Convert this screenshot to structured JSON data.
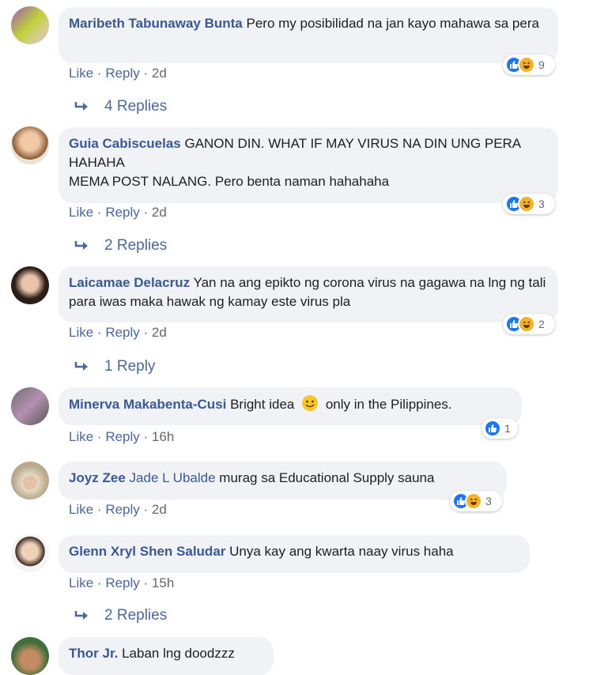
{
  "comments": [
    {
      "author": "Maribeth Tabunaway Bunta",
      "tag": "",
      "text": "Pero my posibilidad na jan kayo mahawa sa pera",
      "reaction_count": "9",
      "like": "Like",
      "reply": "Reply",
      "time": "2d",
      "replies": "4 Replies"
    },
    {
      "author": "Guia Cabiscuelas",
      "tag": "",
      "text": "GANON DIN. WHAT IF MAY VIRUS NA DIN UNG PERA HAHAHA",
      "text2": "MEMA POST NALANG. Pero benta naman hahahaha",
      "reaction_count": "3",
      "like": "Like",
      "reply": "Reply",
      "time": "2d",
      "replies": "2 Replies"
    },
    {
      "author": "Laicamae Delacruz",
      "tag": "",
      "text": "Yan na ang epikto ng corona virus na gagawa na lng ng tali para iwas maka hawak ng kamay este virus pla",
      "reaction_count": "2",
      "like": "Like",
      "reply": "Reply",
      "time": "2d",
      "replies": "1 Reply"
    },
    {
      "author": "Minerva Makabenta-Cusi",
      "tag": "",
      "text": "Bright idea",
      "text_after": "only in the Pilippines.",
      "reaction_count": "1",
      "like": "Like",
      "reply": "Reply",
      "time": "16h",
      "replies": ""
    },
    {
      "author": "Joyz Zee",
      "tag": "Jade L Ubalde",
      "text": "murag sa Educational Supply sauna",
      "reaction_count": "3",
      "like": "Like",
      "reply": "Reply",
      "time": "2d",
      "replies": ""
    },
    {
      "author": "Glenn Xryl Shen Saludar",
      "tag": "",
      "text": "Unya kay ang kwarta naay virus haha",
      "reaction_count": "",
      "like": "Like",
      "reply": "Reply",
      "time": "15h",
      "replies": "2 Replies"
    },
    {
      "author": "Thor Jr.",
      "tag": "",
      "text": "Laban lng doodzzz",
      "reaction_count": "",
      "like": "",
      "reply": "",
      "time": "",
      "replies": ""
    }
  ],
  "icons": {
    "like": "like-reaction-icon",
    "haha": "haha-reaction-icon",
    "reply_arrow": "reply-arrow-icon",
    "smiley": "smiley-emoji-icon"
  },
  "colors": {
    "author": "#385898",
    "link": "#4b67a1",
    "bubble": "#f0f2f5",
    "like": "#1877f2",
    "haha": "#f7b125"
  }
}
